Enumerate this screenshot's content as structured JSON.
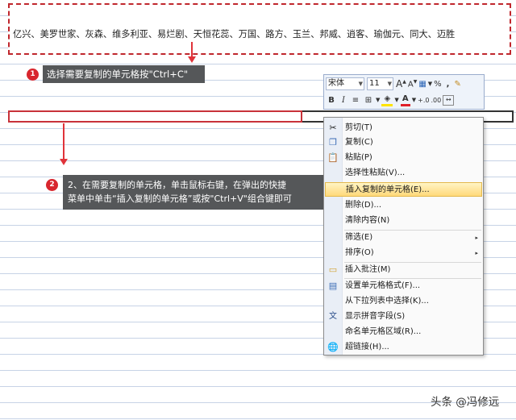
{
  "sheet": {
    "copied_cell_text": "亿兴、美罗世家、灰森、维多利亚、易烂剧、天恒花蕊、万国、路方、玉兰、邦威、逍客、瑜伽元、同大、迈胜"
  },
  "steps": {
    "step1": {
      "number": "1",
      "text": "选择需要复制的单元格按\"Ctrl+C\""
    },
    "step2": {
      "number": "2",
      "line1": "2、在需要复制的单元格，单击鼠标右键，在弹出的快捷",
      "line2": "菜单中单击“插入复制的单元格”或按\"Ctrl+V\"组合键即可"
    }
  },
  "mini_toolbar": {
    "font_name": "宋体",
    "font_size": "11",
    "grow_font": "A",
    "shrink_font": "A",
    "percent": "%",
    "comma": ",",
    "bold": "B",
    "italic": "I",
    "font_color": "A",
    "increase_decimal": "+.0",
    "decrease_decimal": ".00",
    "icons": [
      "grow-font-icon",
      "shrink-font-icon",
      "currency-icon",
      "percent-icon",
      "comma-style-icon",
      "format-painter-icon",
      "borders-icon",
      "fill-color-icon",
      "font-color-icon",
      "merge-center-icon"
    ]
  },
  "context_menu": {
    "items": [
      {
        "label": "剪切(T)",
        "icon": "cut-icon"
      },
      {
        "label": "复制(C)",
        "icon": "copy-icon"
      },
      {
        "label": "粘贴(P)",
        "icon": "paste-icon"
      },
      {
        "label": "选择性粘贴(V)...",
        "icon": ""
      },
      {
        "label": "插入复制的单元格(E)...",
        "icon": ""
      },
      {
        "label": "删除(D)...",
        "icon": ""
      },
      {
        "label": "清除内容(N)",
        "icon": ""
      },
      {
        "label": "筛选(E)",
        "icon": "",
        "submenu": "▸"
      },
      {
        "label": "排序(O)",
        "icon": "",
        "submenu": "▸"
      },
      {
        "label": "插入批注(M)",
        "icon": "comment-icon"
      },
      {
        "label": "设置单元格格式(F)...",
        "icon": "format-cells-icon"
      },
      {
        "label": "从下拉列表中选择(K)...",
        "icon": ""
      },
      {
        "label": "显示拼音字段(S)",
        "icon": "phonetic-icon"
      },
      {
        "label": "命名单元格区域(R)...",
        "icon": ""
      },
      {
        "label": "超链接(H)...",
        "icon": "hyperlink-icon"
      }
    ],
    "highlighted_index": 4
  },
  "watermark": "头条 @冯修远",
  "colors": {
    "accent_red": "#d8262e",
    "callout_bg": "#555759",
    "menu_highlight": "#ffd97a"
  }
}
